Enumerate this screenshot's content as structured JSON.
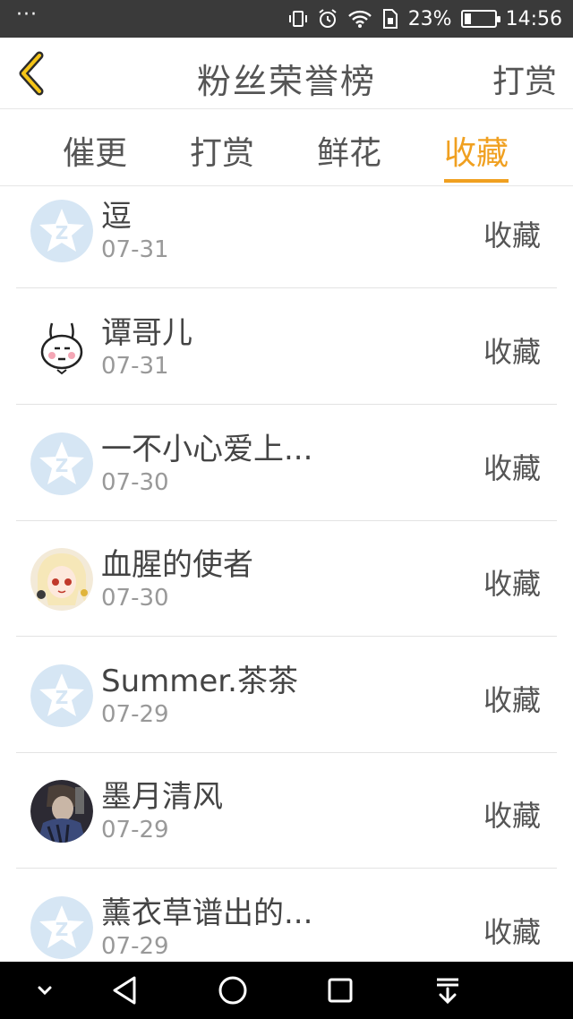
{
  "status_bar": {
    "dots": "···",
    "battery_percent": "23%",
    "battery_level": 0.23,
    "time": "14:56"
  },
  "header": {
    "title": "粉丝荣誉榜",
    "action_label": "打赏"
  },
  "tabs": [
    {
      "label": "催更",
      "active": false
    },
    {
      "label": "打赏",
      "active": false
    },
    {
      "label": "鲜花",
      "active": false
    },
    {
      "label": "收藏",
      "active": true
    }
  ],
  "list": {
    "items": [
      {
        "name": "逗",
        "date": "07-31",
        "action": "收藏",
        "avatar": "default-star-avatar"
      },
      {
        "name": "谭哥儿",
        "date": "07-31",
        "action": "收藏",
        "avatar": "rabbit-avatar"
      },
      {
        "name": "一不小心爱上...",
        "date": "07-30",
        "action": "收藏",
        "avatar": "default-star-avatar"
      },
      {
        "name": "血腥的使者",
        "date": "07-30",
        "action": "收藏",
        "avatar": "anime-girl-avatar"
      },
      {
        "name": "Summer.茶茶",
        "date": "07-29",
        "action": "收藏",
        "avatar": "default-star-avatar"
      },
      {
        "name": "墨月清风",
        "date": "07-29",
        "action": "收藏",
        "avatar": "dark-photo-avatar"
      },
      {
        "name": "薰衣草谱出的...",
        "date": "07-29",
        "action": "收藏",
        "avatar": "default-star-avatar"
      }
    ]
  },
  "colors": {
    "accent": "#f0a020",
    "status_bar_bg": "#3a3a3a",
    "default_avatar_bg": "#d6e6f4"
  }
}
